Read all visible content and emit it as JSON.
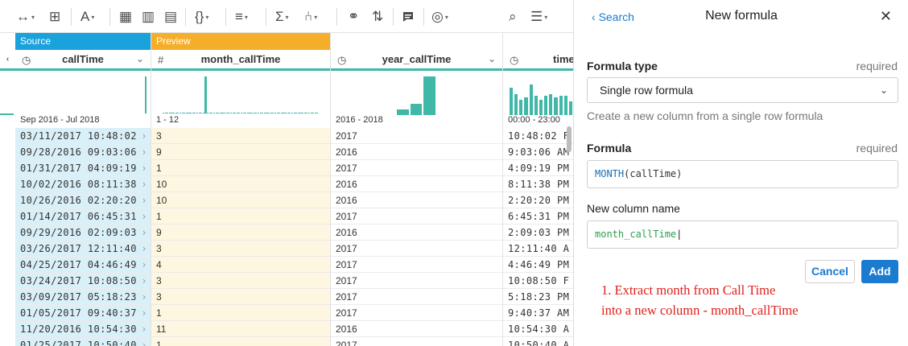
{
  "toolbar": {
    "items": [
      {
        "name": "column-move-icon",
        "glyph": "↔"
      },
      {
        "name": "split-column-icon",
        "glyph": "⊞"
      },
      {
        "name": "text-format-icon",
        "glyph": "A"
      },
      {
        "name": "table-fill-icon",
        "glyph": "▦"
      },
      {
        "name": "table-select-icon",
        "glyph": "▥"
      },
      {
        "name": "table-edit-icon",
        "glyph": "▤"
      },
      {
        "name": "formula-braces-icon",
        "glyph": "{}"
      },
      {
        "name": "filter-icon",
        "glyph": "≡"
      },
      {
        "name": "sigma-icon",
        "glyph": "Σ"
      },
      {
        "name": "merge-icon",
        "glyph": "⑃"
      },
      {
        "name": "join-icon",
        "glyph": "⚭"
      },
      {
        "name": "sort-icon",
        "glyph": "⇅"
      },
      {
        "name": "comment-icon",
        "glyph": "▪"
      },
      {
        "name": "target-icon",
        "glyph": "◎"
      },
      {
        "name": "search-column-icon",
        "glyph": "⌕"
      },
      {
        "name": "settings-sliders-icon",
        "glyph": "☰"
      }
    ]
  },
  "grid": {
    "source_tag": "Source",
    "preview_tag": "Preview",
    "columns": [
      {
        "name": "callTime",
        "type_icon": "◷",
        "range": "Sep 2016 - Jul 2018"
      },
      {
        "name": "month_callTime",
        "type_icon": "#",
        "range": "1 - 12"
      },
      {
        "name": "year_callTime",
        "type_icon": "◷",
        "range": "2016 - 2018"
      },
      {
        "name": "time",
        "type_icon": "◷",
        "range": "00:00 - 23:00"
      }
    ],
    "rows": [
      [
        "03/11/2017 10:48:02",
        "3",
        "2017",
        "10:48:02 F"
      ],
      [
        "09/28/2016 09:03:06",
        "9",
        "2016",
        "9:03:06 AM"
      ],
      [
        "01/31/2017 04:09:19",
        "1",
        "2017",
        "4:09:19 PM"
      ],
      [
        "10/02/2016 08:11:38",
        "10",
        "2016",
        "8:11:38 PM"
      ],
      [
        "10/26/2016 02:20:20",
        "10",
        "2016",
        "2:20:20 PM"
      ],
      [
        "01/14/2017 06:45:31",
        "1",
        "2017",
        "6:45:31 PM"
      ],
      [
        "09/29/2016 02:09:03",
        "9",
        "2016",
        "2:09:03 PM"
      ],
      [
        "03/26/2017 12:11:40",
        "3",
        "2017",
        "12:11:40 A"
      ],
      [
        "04/25/2017 04:46:49",
        "4",
        "2017",
        "4:46:49 PM"
      ],
      [
        "03/24/2017 10:08:50",
        "3",
        "2017",
        "10:08:50 F"
      ],
      [
        "03/09/2017 05:18:23",
        "3",
        "2017",
        "5:18:23 PM"
      ],
      [
        "01/05/2017 09:40:37",
        "1",
        "2017",
        "9:40:37 AM"
      ],
      [
        "11/20/2016 10:54:30",
        "11",
        "2016",
        "10:54:30 A"
      ],
      [
        "01/25/2017 10:50:40",
        "1",
        "2017",
        "10:50:40 A"
      ]
    ],
    "histograms": {
      "callTime": [
        0.02,
        0.04,
        0.04,
        0.04,
        0.04,
        0.04,
        0.04,
        0.04,
        0.04,
        0.04,
        0.04,
        0.04,
        0.04,
        0.04,
        0.04,
        0.04,
        0.04,
        0.04,
        0.04,
        0.04,
        0.04,
        0.04,
        0.04,
        0.04,
        0.04,
        0.04,
        0.04,
        0.04,
        0.04,
        0.04,
        0.04,
        0.04,
        0.04,
        0.04,
        0.04,
        0.04,
        0.04,
        0.04,
        0.04,
        0.04,
        0.04,
        0.04,
        0.04,
        0.04,
        0.04,
        0.04,
        0.04,
        0.04,
        0.04,
        0.04,
        0.04,
        0.04,
        0.04,
        0.04,
        0.04,
        0.04,
        0.04,
        0.04,
        0.04,
        0.04,
        0.04,
        0.04,
        1.0,
        0.04
      ],
      "month_callTime": [
        0.06,
        0.06,
        0.06,
        0.06,
        0.06,
        0.06,
        0.06,
        0.06,
        0.06,
        0.06,
        0.06,
        0.06,
        0.06,
        0.06,
        0.06,
        0.06,
        0.06,
        0.06,
        0.06,
        0.06,
        1.0,
        0.06,
        0.06,
        0.06,
        0.06,
        0.06,
        0.06,
        0.06,
        0.06,
        0.06,
        0.06,
        0.06,
        0.06,
        0.06,
        0.06,
        0.06,
        0.06,
        0.06,
        0.06,
        0.06,
        0.06,
        0.06,
        0.06,
        0.06,
        0.06,
        0.06,
        0.06,
        0.06,
        0.06,
        0.06,
        0.06,
        0.06,
        0.06,
        0.06,
        0.06,
        0.06,
        0.06,
        0.06,
        0.06,
        0.06,
        0.06,
        0.06,
        0.06,
        0.06,
        0.06,
        0.06,
        0.06,
        0.06,
        0.06,
        0.06,
        0.06,
        0.06,
        0.06,
        0.06
      ],
      "year_callTime": [
        0.15,
        0.3,
        1.0
      ],
      "time": [
        0.7,
        0.55,
        0.4,
        0.45,
        0.8,
        0.5,
        0.4,
        0.5,
        0.55,
        0.45,
        0.5,
        0.5,
        0.35
      ]
    }
  },
  "panel": {
    "back_label": "Search",
    "title": "New formula",
    "formula_type_label": "Formula type",
    "formula_type_required": "required",
    "formula_type_value": "Single row formula",
    "formula_type_help": "Create a new column from a single row formula",
    "formula_label": "Formula",
    "formula_required": "required",
    "formula_fn": "MONTH",
    "formula_args": "(callTime)",
    "new_col_label": "New column name",
    "new_col_value": "month_callTime",
    "cancel_label": "Cancel",
    "add_label": "Add"
  },
  "annotation": {
    "line1": "1. Extract month from Call Time",
    "line2": "into a new column - month_callTime"
  },
  "colors": {
    "accent": "#1a7bd1",
    "teal": "#3fb8a7",
    "source_tag": "#1aa2dc",
    "preview_tag": "#f5ae2a",
    "annotation": "#e0201a"
  }
}
